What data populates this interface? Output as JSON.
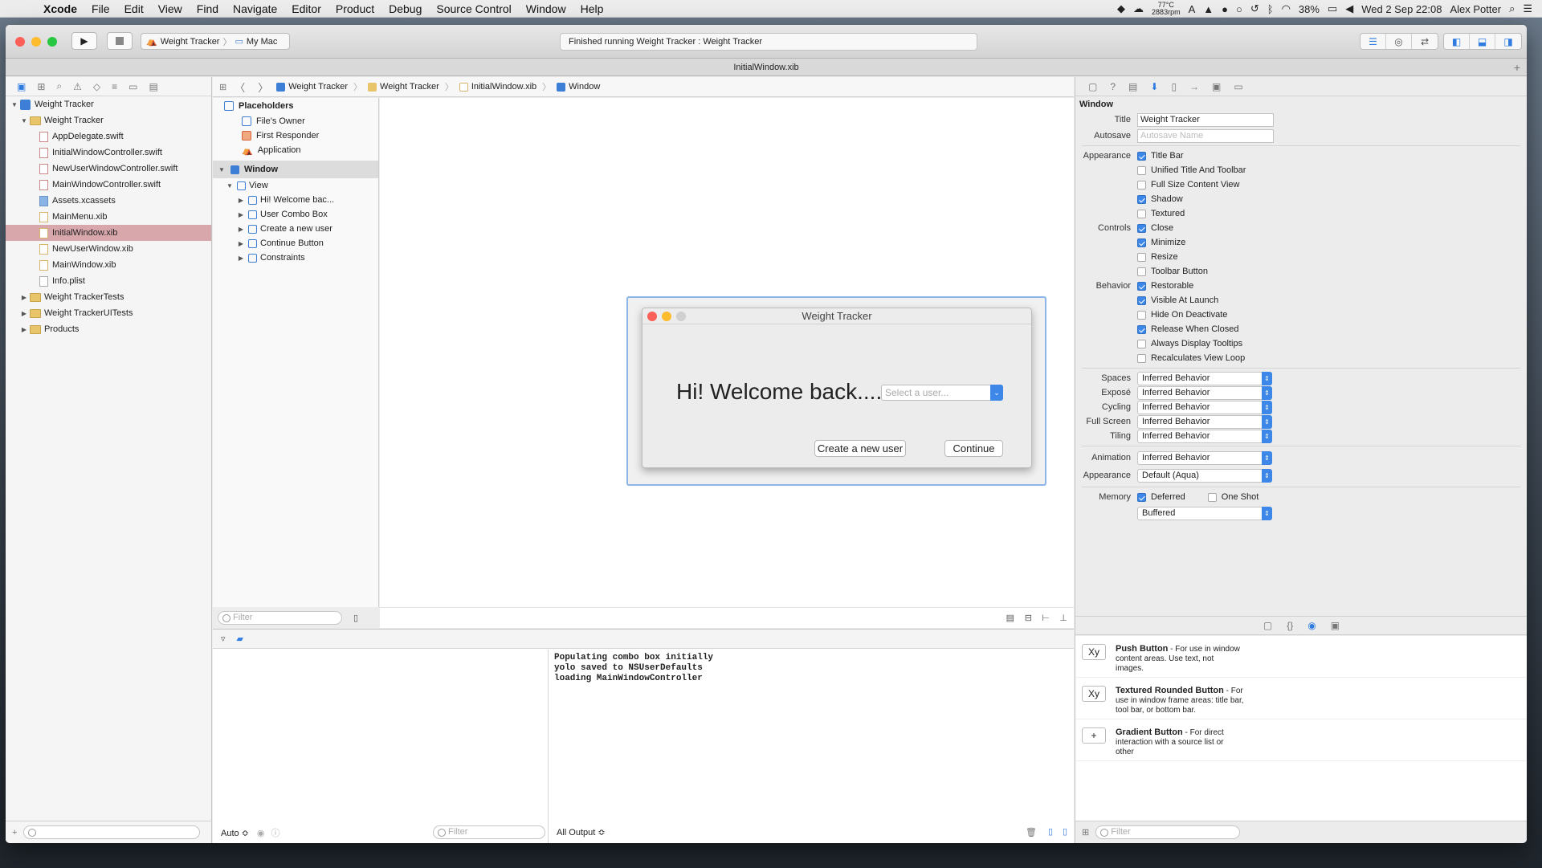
{
  "menubar": {
    "app": "Xcode",
    "items": [
      "File",
      "Edit",
      "View",
      "Find",
      "Navigate",
      "Editor",
      "Product",
      "Debug",
      "Source Control",
      "Window",
      "Help"
    ],
    "temp": "77°C",
    "rpm": "2883rpm",
    "battery": "38%",
    "clock": "Wed 2 Sep  22:08",
    "user": "Alex Potter"
  },
  "toolbar": {
    "scheme": "Weight Tracker",
    "destination": "My Mac",
    "activity": "Finished running Weight Tracker : Weight Tracker"
  },
  "tab": {
    "title": "InitialWindow.xib"
  },
  "navigator": {
    "tree": [
      {
        "label": "Weight Tracker",
        "kind": "project",
        "level": 0,
        "open": true
      },
      {
        "label": "Weight Tracker",
        "kind": "folder",
        "level": 1,
        "open": true
      },
      {
        "label": "AppDelegate.swift",
        "kind": "swift",
        "level": 2
      },
      {
        "label": "InitialWindowController.swift",
        "kind": "swift",
        "level": 2
      },
      {
        "label": "NewUserWindowController.swift",
        "kind": "swift",
        "level": 2
      },
      {
        "label": "MainWindowController.swift",
        "kind": "swift",
        "level": 2
      },
      {
        "label": "Assets.xcassets",
        "kind": "asset",
        "level": 2
      },
      {
        "label": "MainMenu.xib",
        "kind": "xib",
        "level": 2
      },
      {
        "label": "InitialWindow.xib",
        "kind": "xib",
        "level": 2,
        "selected": true
      },
      {
        "label": "NewUserWindow.xib",
        "kind": "xib",
        "level": 2
      },
      {
        "label": "MainWindow.xib",
        "kind": "xib",
        "level": 2
      },
      {
        "label": "Info.plist",
        "kind": "plist",
        "level": 2
      },
      {
        "label": "Weight TrackerTests",
        "kind": "folder",
        "level": 1,
        "open": false
      },
      {
        "label": "Weight TrackerUITests",
        "kind": "folder",
        "level": 1,
        "open": false
      },
      {
        "label": "Products",
        "kind": "folder",
        "level": 1,
        "open": false
      }
    ]
  },
  "jumpbar": {
    "crumbs": [
      "Weight Tracker",
      "Weight Tracker",
      "InitialWindow.xib",
      "Window"
    ]
  },
  "outline": {
    "placeholders_label": "Placeholders",
    "placeholders": [
      "File's Owner",
      "First Responder",
      "Application"
    ],
    "window_label": "Window",
    "view_label": "View",
    "children": [
      "Hi! Welcome bac...",
      "User Combo Box",
      "Create a new user",
      "Continue Button",
      "Constraints"
    ],
    "filter_placeholder": "Filter"
  },
  "design": {
    "window_title": "Weight Tracker",
    "welcome": "Hi! Welcome back....",
    "combo_placeholder": "Select a user...",
    "create_button": "Create a new user",
    "continue_button": "Continue"
  },
  "debug": {
    "console_lines": [
      "Populating combo box initially",
      "yolo saved to NSUserDefaults",
      "loading MainWindowController"
    ],
    "auto_label": "Auto ≎",
    "filter_placeholder": "Filter",
    "output_label": "All Output ≎"
  },
  "inspector": {
    "section": "Window",
    "title_label": "Title",
    "title_value": "Weight Tracker",
    "autosave_label": "Autosave",
    "autosave_placeholder": "Autosave Name",
    "appearance_label": "Appearance",
    "appearance_opts": [
      {
        "label": "Title Bar",
        "on": true
      },
      {
        "label": "Unified Title And Toolbar",
        "on": false
      },
      {
        "label": "Full Size Content View",
        "on": false
      },
      {
        "label": "Shadow",
        "on": true
      },
      {
        "label": "Textured",
        "on": false
      }
    ],
    "controls_label": "Controls",
    "controls_opts": [
      {
        "label": "Close",
        "on": true
      },
      {
        "label": "Minimize",
        "on": true
      },
      {
        "label": "Resize",
        "on": false
      },
      {
        "label": "Toolbar Button",
        "on": false
      }
    ],
    "behavior_label": "Behavior",
    "behavior_opts": [
      {
        "label": "Restorable",
        "on": true
      },
      {
        "label": "Visible At Launch",
        "on": true
      },
      {
        "label": "Hide On Deactivate",
        "on": false
      },
      {
        "label": "Release When Closed",
        "on": true
      },
      {
        "label": "Always Display Tooltips",
        "on": false
      },
      {
        "label": "Recalculates View Loop",
        "on": false
      }
    ],
    "popups": [
      {
        "label": "Spaces",
        "value": "Inferred Behavior"
      },
      {
        "label": "Exposé",
        "value": "Inferred Behavior"
      },
      {
        "label": "Cycling",
        "value": "Inferred Behavior"
      },
      {
        "label": "Full Screen",
        "value": "Inferred Behavior"
      },
      {
        "label": "Tiling",
        "value": "Inferred Behavior"
      }
    ],
    "animation_label": "Animation",
    "animation_value": "Inferred Behavior",
    "appearance2_label": "Appearance",
    "appearance2_value": "Default (Aqua)",
    "memory_label": "Memory",
    "deferred": "Deferred",
    "one_shot": "One Shot",
    "backing": "Buffered"
  },
  "library": {
    "items": [
      {
        "icon": "Xy",
        "name": "Push Button",
        "desc": " - For use in window content areas. Use text, not images."
      },
      {
        "icon": "Xy",
        "name": "Textured Rounded Button",
        "desc": " - For use in window frame areas: title bar, tool bar, or bottom bar."
      },
      {
        "icon": "+",
        "name": "Gradient Button",
        "desc": " - For direct interaction with a source list or other"
      }
    ],
    "filter_placeholder": "Filter"
  }
}
